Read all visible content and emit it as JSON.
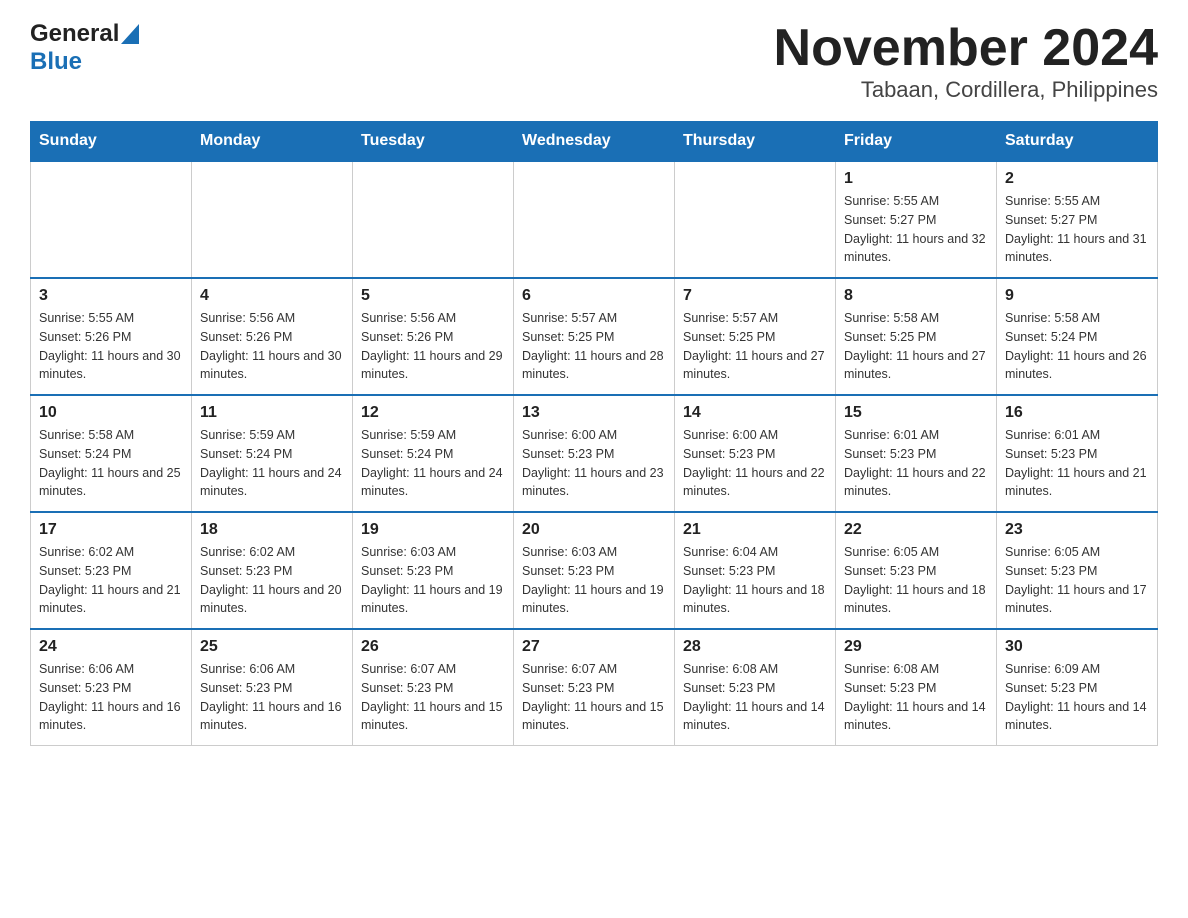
{
  "header": {
    "logo_general": "General",
    "logo_blue": "Blue",
    "title": "November 2024",
    "subtitle": "Tabaan, Cordillera, Philippines"
  },
  "days_of_week": [
    "Sunday",
    "Monday",
    "Tuesday",
    "Wednesday",
    "Thursday",
    "Friday",
    "Saturday"
  ],
  "weeks": [
    [
      {
        "day": "",
        "sunrise": "",
        "sunset": "",
        "daylight": ""
      },
      {
        "day": "",
        "sunrise": "",
        "sunset": "",
        "daylight": ""
      },
      {
        "day": "",
        "sunrise": "",
        "sunset": "",
        "daylight": ""
      },
      {
        "day": "",
        "sunrise": "",
        "sunset": "",
        "daylight": ""
      },
      {
        "day": "",
        "sunrise": "",
        "sunset": "",
        "daylight": ""
      },
      {
        "day": "1",
        "sunrise": "Sunrise: 5:55 AM",
        "sunset": "Sunset: 5:27 PM",
        "daylight": "Daylight: 11 hours and 32 minutes."
      },
      {
        "day": "2",
        "sunrise": "Sunrise: 5:55 AM",
        "sunset": "Sunset: 5:27 PM",
        "daylight": "Daylight: 11 hours and 31 minutes."
      }
    ],
    [
      {
        "day": "3",
        "sunrise": "Sunrise: 5:55 AM",
        "sunset": "Sunset: 5:26 PM",
        "daylight": "Daylight: 11 hours and 30 minutes."
      },
      {
        "day": "4",
        "sunrise": "Sunrise: 5:56 AM",
        "sunset": "Sunset: 5:26 PM",
        "daylight": "Daylight: 11 hours and 30 minutes."
      },
      {
        "day": "5",
        "sunrise": "Sunrise: 5:56 AM",
        "sunset": "Sunset: 5:26 PM",
        "daylight": "Daylight: 11 hours and 29 minutes."
      },
      {
        "day": "6",
        "sunrise": "Sunrise: 5:57 AM",
        "sunset": "Sunset: 5:25 PM",
        "daylight": "Daylight: 11 hours and 28 minutes."
      },
      {
        "day": "7",
        "sunrise": "Sunrise: 5:57 AM",
        "sunset": "Sunset: 5:25 PM",
        "daylight": "Daylight: 11 hours and 27 minutes."
      },
      {
        "day": "8",
        "sunrise": "Sunrise: 5:58 AM",
        "sunset": "Sunset: 5:25 PM",
        "daylight": "Daylight: 11 hours and 27 minutes."
      },
      {
        "day": "9",
        "sunrise": "Sunrise: 5:58 AM",
        "sunset": "Sunset: 5:24 PM",
        "daylight": "Daylight: 11 hours and 26 minutes."
      }
    ],
    [
      {
        "day": "10",
        "sunrise": "Sunrise: 5:58 AM",
        "sunset": "Sunset: 5:24 PM",
        "daylight": "Daylight: 11 hours and 25 minutes."
      },
      {
        "day": "11",
        "sunrise": "Sunrise: 5:59 AM",
        "sunset": "Sunset: 5:24 PM",
        "daylight": "Daylight: 11 hours and 24 minutes."
      },
      {
        "day": "12",
        "sunrise": "Sunrise: 5:59 AM",
        "sunset": "Sunset: 5:24 PM",
        "daylight": "Daylight: 11 hours and 24 minutes."
      },
      {
        "day": "13",
        "sunrise": "Sunrise: 6:00 AM",
        "sunset": "Sunset: 5:23 PM",
        "daylight": "Daylight: 11 hours and 23 minutes."
      },
      {
        "day": "14",
        "sunrise": "Sunrise: 6:00 AM",
        "sunset": "Sunset: 5:23 PM",
        "daylight": "Daylight: 11 hours and 22 minutes."
      },
      {
        "day": "15",
        "sunrise": "Sunrise: 6:01 AM",
        "sunset": "Sunset: 5:23 PM",
        "daylight": "Daylight: 11 hours and 22 minutes."
      },
      {
        "day": "16",
        "sunrise": "Sunrise: 6:01 AM",
        "sunset": "Sunset: 5:23 PM",
        "daylight": "Daylight: 11 hours and 21 minutes."
      }
    ],
    [
      {
        "day": "17",
        "sunrise": "Sunrise: 6:02 AM",
        "sunset": "Sunset: 5:23 PM",
        "daylight": "Daylight: 11 hours and 21 minutes."
      },
      {
        "day": "18",
        "sunrise": "Sunrise: 6:02 AM",
        "sunset": "Sunset: 5:23 PM",
        "daylight": "Daylight: 11 hours and 20 minutes."
      },
      {
        "day": "19",
        "sunrise": "Sunrise: 6:03 AM",
        "sunset": "Sunset: 5:23 PM",
        "daylight": "Daylight: 11 hours and 19 minutes."
      },
      {
        "day": "20",
        "sunrise": "Sunrise: 6:03 AM",
        "sunset": "Sunset: 5:23 PM",
        "daylight": "Daylight: 11 hours and 19 minutes."
      },
      {
        "day": "21",
        "sunrise": "Sunrise: 6:04 AM",
        "sunset": "Sunset: 5:23 PM",
        "daylight": "Daylight: 11 hours and 18 minutes."
      },
      {
        "day": "22",
        "sunrise": "Sunrise: 6:05 AM",
        "sunset": "Sunset: 5:23 PM",
        "daylight": "Daylight: 11 hours and 18 minutes."
      },
      {
        "day": "23",
        "sunrise": "Sunrise: 6:05 AM",
        "sunset": "Sunset: 5:23 PM",
        "daylight": "Daylight: 11 hours and 17 minutes."
      }
    ],
    [
      {
        "day": "24",
        "sunrise": "Sunrise: 6:06 AM",
        "sunset": "Sunset: 5:23 PM",
        "daylight": "Daylight: 11 hours and 16 minutes."
      },
      {
        "day": "25",
        "sunrise": "Sunrise: 6:06 AM",
        "sunset": "Sunset: 5:23 PM",
        "daylight": "Daylight: 11 hours and 16 minutes."
      },
      {
        "day": "26",
        "sunrise": "Sunrise: 6:07 AM",
        "sunset": "Sunset: 5:23 PM",
        "daylight": "Daylight: 11 hours and 15 minutes."
      },
      {
        "day": "27",
        "sunrise": "Sunrise: 6:07 AM",
        "sunset": "Sunset: 5:23 PM",
        "daylight": "Daylight: 11 hours and 15 minutes."
      },
      {
        "day": "28",
        "sunrise": "Sunrise: 6:08 AM",
        "sunset": "Sunset: 5:23 PM",
        "daylight": "Daylight: 11 hours and 14 minutes."
      },
      {
        "day": "29",
        "sunrise": "Sunrise: 6:08 AM",
        "sunset": "Sunset: 5:23 PM",
        "daylight": "Daylight: 11 hours and 14 minutes."
      },
      {
        "day": "30",
        "sunrise": "Sunrise: 6:09 AM",
        "sunset": "Sunset: 5:23 PM",
        "daylight": "Daylight: 11 hours and 14 minutes."
      }
    ]
  ]
}
